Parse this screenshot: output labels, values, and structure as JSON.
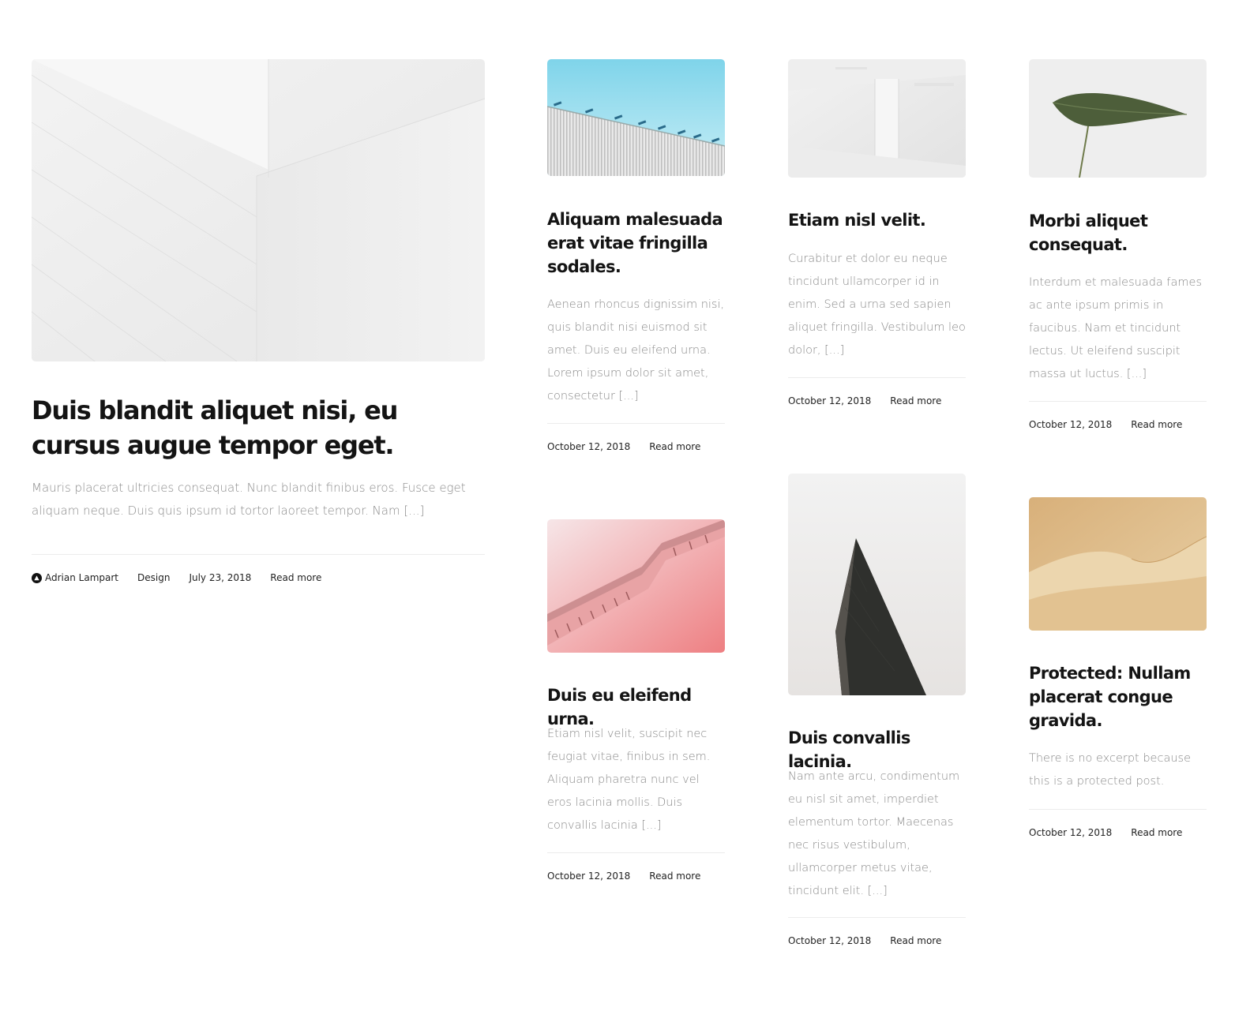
{
  "featured": {
    "title": "Duis blandit aliquet nisi, eu cursus augue tempor eget.",
    "excerpt": "Mauris placerat ultricies consequat. Nunc blandit finibus eros. Fusce eget aliquam neque. Duis quis ipsum id tortor laoreet tempor. Nam [...]",
    "author": "Adrian Lampart",
    "category": "Design",
    "date": "July 23, 2018",
    "read_more": "Read more",
    "image_icon": "white-architecture-image"
  },
  "posts": [
    {
      "title": "Aliquam malesuada erat vitae fringilla sodales.",
      "excerpt": "Aenean rhoncus dignissim nisi, quis blandit nisi euismod sit amet. Duis eu eleifend urna. Lorem ipsum dolor sit amet, consectetur [...]",
      "date": "October 12, 2018",
      "read_more": "Read more",
      "image_icon": "blue-sky-fence-image"
    },
    {
      "title": "Etiam nisl velit.",
      "excerpt": "Curabitur et dolor eu neque tincidunt ullamcorper id in enim. Sed a urna sed sapien aliquet fringilla. Vestibulum leo dolor, [...]",
      "date": "October 12, 2018",
      "read_more": "Read more",
      "image_icon": "white-room-image"
    },
    {
      "title": "Morbi aliquet consequat.",
      "excerpt": "Interdum et malesuada fames ac ante ipsum primis in faucibus. Nam et tincidunt lectus. Ut eleifend suscipit massa ut luctus. [...]",
      "date": "October 12, 2018",
      "read_more": "Read more",
      "image_icon": "green-leaf-image"
    },
    {
      "title": "Duis eu eleifend urna.",
      "excerpt": "Etiam nisl velit, suscipit nec feugiat vitae, finibus in sem. Aliquam pharetra nunc vel eros lacinia mollis. Duis convallis lacinia [...]",
      "date": "October 12, 2018",
      "read_more": "Read more",
      "image_icon": "pink-escalator-image"
    },
    {
      "title": "Duis convallis lacinia.",
      "excerpt": "Nam ante arcu, condimentum eu nisl sit amet, imperdiet elementum tortor. Maecenas nec risus vestibulum, ullamcorper metus vitae, tincidunt elit. [...]",
      "date": "October 12, 2018",
      "read_more": "Read more",
      "image_icon": "dark-tower-image"
    },
    {
      "title": "Protected: Nullam placerat congue gravida.",
      "excerpt": "There is no excerpt because this is a protected post.",
      "date": "October 12, 2018",
      "read_more": "Read more",
      "image_icon": "sand-dune-image"
    }
  ],
  "colors": {
    "title": "#141414",
    "excerpt": "#8a8a8a",
    "divider": "#ececec"
  }
}
